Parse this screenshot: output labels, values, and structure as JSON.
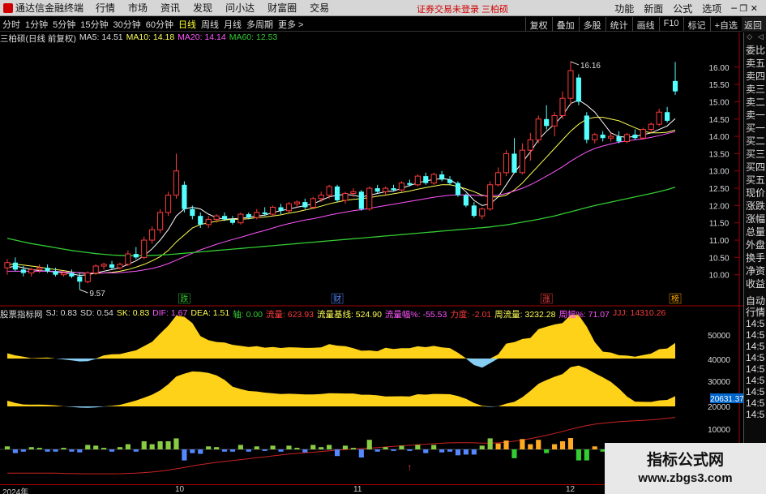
{
  "app": {
    "title": "通达信金融终端",
    "menu": [
      "行情",
      "市场",
      "资讯",
      "发现",
      "问小达",
      "财富圈",
      "交易"
    ],
    "notice": "证券交易未登录  三柏硕",
    "right_menu": [
      "功能",
      "新面",
      "公式",
      "选项"
    ],
    "window_controls": "─ ❐ ✕"
  },
  "periods": {
    "items": [
      "分时",
      "1分钟",
      "5分钟",
      "15分钟",
      "30分钟",
      "60分钟",
      "日线",
      "周线",
      "月线",
      "多周期",
      "更多 >"
    ],
    "active": "日线"
  },
  "tools": [
    "复权",
    "叠加",
    "多股",
    "统计",
    "画线",
    "F10",
    "标记",
    "+自选"
  ],
  "back_label": "返回",
  "main_header": {
    "name": "三柏硕(日线 前复权)",
    "ma5": "MA5: 14.51",
    "ma10": "MA10: 14.18",
    "ma20": "MA20: 14.14",
    "ma60": "MA60: 12.53"
  },
  "price_axis": [
    "16.00",
    "15.50",
    "15.00",
    "14.50",
    "14.00",
    "13.50",
    "13.00",
    "12.50",
    "12.00",
    "11.50",
    "11.00",
    "10.50",
    "10.00"
  ],
  "annotations": {
    "high": "16.16",
    "low": "9.57"
  },
  "markers": [
    "跌",
    "财",
    "涨",
    "榜"
  ],
  "right_panel": [
    "委比",
    "卖五",
    "卖四",
    "卖三",
    "卖二",
    "卖一",
    "买一",
    "买二",
    "买三",
    "买四",
    "买五",
    "现价",
    "涨跌",
    "涨幅",
    "总量",
    "外盘",
    "换手",
    "净资",
    "收益"
  ],
  "right_panel_lower": [
    "自动",
    "行情",
    "14:5",
    "14:5",
    "14:5",
    "14:5",
    "14:5",
    "14:5",
    "14:5",
    "14:5",
    "14:5"
  ],
  "indicator_header": {
    "name": "股票指标网",
    "sj": "SJ: 0.83",
    "sd": "SD: 0.54",
    "sk": "SK: 0.83",
    "dif": "DIF: 1.67",
    "dea": "DEA: 1.51",
    "zhou": "轴: 0.00",
    "liuliang": "流量: 623.93",
    "jixian": "流量基线: 524.90",
    "fudu": "流量幅%: -55.53",
    "lidu": "力度: -2.01",
    "zhouliang": "周流量: 3232.28",
    "zhoufu": "周幅%: 71.07",
    "jjj": "JJJ: 14310.26"
  },
  "indicator_axis": [
    "50000",
    "40000",
    "30000",
    "20000",
    "10000"
  ],
  "indicator_highlight": "20631.37",
  "time_axis": [
    "2024年",
    "10",
    "11",
    "12"
  ],
  "watermark": {
    "line1": "指标公式网",
    "line2": "www.zbgs3.com"
  },
  "colors": {
    "up": "#ff3b3b",
    "down": "#54ffff",
    "ma5": "#ffffff",
    "ma10": "#ffff55",
    "ma20": "#ff55ff",
    "ma60": "#33cc33",
    "yellow_fill": "#ffd21a",
    "blue_fill": "#87cef5"
  },
  "chart_data": {
    "type": "candlestick",
    "title": "三柏硕(日线 前复权)",
    "ylim": [
      9.5,
      16.3
    ],
    "series": [
      {
        "name": "K线",
        "ohlc": [
          [
            10.2,
            10.45,
            10.0,
            10.35
          ],
          [
            10.35,
            10.5,
            10.1,
            10.15
          ],
          [
            10.15,
            10.25,
            9.95,
            10.05
          ],
          [
            10.05,
            10.2,
            9.95,
            10.15
          ],
          [
            10.15,
            10.3,
            10.05,
            10.2
          ],
          [
            10.2,
            10.3,
            10.05,
            10.1
          ],
          [
            10.1,
            10.2,
            9.95,
            10.0
          ],
          [
            10.0,
            10.1,
            9.95,
            10.05
          ],
          [
            10.05,
            10.15,
            9.9,
            9.95
          ],
          [
            9.95,
            10.05,
            9.57,
            9.8
          ],
          [
            9.8,
            10.1,
            9.75,
            10.05
          ],
          [
            10.05,
            10.3,
            10.0,
            10.25
          ],
          [
            10.25,
            10.35,
            10.15,
            10.3
          ],
          [
            10.3,
            10.4,
            10.15,
            10.2
          ],
          [
            10.2,
            10.35,
            10.15,
            10.3
          ],
          [
            10.3,
            10.7,
            10.25,
            10.6
          ],
          [
            10.6,
            10.8,
            10.45,
            10.5
          ],
          [
            10.5,
            11.1,
            10.45,
            11.0
          ],
          [
            11.0,
            11.4,
            10.9,
            11.3
          ],
          [
            11.3,
            11.9,
            11.2,
            11.8
          ],
          [
            11.8,
            12.4,
            11.7,
            12.3
          ],
          [
            12.3,
            13.5,
            12.2,
            13.0
          ],
          [
            12.6,
            12.7,
            11.8,
            11.9
          ],
          [
            11.9,
            12.0,
            11.6,
            11.7
          ],
          [
            11.7,
            11.8,
            11.35,
            11.45
          ],
          [
            11.45,
            11.7,
            11.35,
            11.6
          ],
          [
            11.6,
            11.75,
            11.5,
            11.7
          ],
          [
            11.7,
            11.8,
            11.55,
            11.6
          ],
          [
            11.6,
            11.7,
            11.45,
            11.5
          ],
          [
            11.5,
            11.8,
            11.45,
            11.75
          ],
          [
            11.75,
            11.8,
            11.6,
            11.65
          ],
          [
            11.65,
            11.9,
            11.6,
            11.8
          ],
          [
            11.8,
            11.95,
            11.7,
            11.75
          ],
          [
            11.75,
            12.0,
            11.7,
            11.95
          ],
          [
            11.95,
            12.05,
            11.75,
            11.85
          ],
          [
            11.85,
            12.1,
            11.8,
            12.05
          ],
          [
            12.05,
            12.15,
            11.95,
            12.1
          ],
          [
            12.1,
            12.2,
            11.9,
            11.95
          ],
          [
            11.95,
            12.25,
            11.9,
            12.2
          ],
          [
            12.2,
            12.4,
            12.1,
            12.3
          ],
          [
            12.3,
            12.6,
            12.2,
            12.55
          ],
          [
            12.55,
            12.6,
            12.1,
            12.15
          ],
          [
            12.15,
            12.4,
            12.05,
            12.35
          ],
          [
            12.35,
            12.5,
            12.25,
            12.4
          ],
          [
            12.4,
            12.45,
            11.85,
            11.9
          ],
          [
            11.9,
            12.55,
            11.85,
            12.5
          ],
          [
            12.5,
            12.6,
            12.35,
            12.4
          ],
          [
            12.4,
            12.55,
            12.3,
            12.5
          ],
          [
            12.5,
            12.6,
            12.4,
            12.45
          ],
          [
            12.45,
            12.7,
            12.4,
            12.65
          ],
          [
            12.65,
            12.75,
            12.55,
            12.6
          ],
          [
            12.6,
            12.9,
            12.55,
            12.85
          ],
          [
            12.85,
            12.95,
            12.6,
            12.65
          ],
          [
            12.65,
            12.95,
            12.6,
            12.9
          ],
          [
            12.9,
            13.0,
            12.7,
            12.75
          ],
          [
            12.75,
            12.85,
            12.6,
            12.65
          ],
          [
            12.65,
            12.7,
            12.25,
            12.3
          ],
          [
            12.3,
            12.35,
            11.95,
            12.0
          ],
          [
            12.0,
            12.1,
            11.65,
            11.7
          ],
          [
            11.7,
            11.95,
            11.6,
            11.9
          ],
          [
            11.9,
            12.7,
            11.85,
            12.6
          ],
          [
            12.6,
            13.1,
            12.55,
            12.95
          ],
          [
            12.95,
            13.6,
            12.85,
            13.5
          ],
          [
            13.5,
            13.95,
            13.2,
            12.95
          ],
          [
            12.95,
            13.8,
            12.9,
            13.6
          ],
          [
            13.6,
            14.1,
            13.3,
            13.9
          ],
          [
            13.9,
            14.6,
            13.8,
            14.5
          ],
          [
            14.5,
            14.9,
            14.2,
            14.3
          ],
          [
            14.3,
            14.7,
            14.0,
            14.6
          ],
          [
            14.6,
            15.3,
            14.5,
            15.1
          ],
          [
            15.1,
            16.16,
            14.9,
            15.9
          ],
          [
            15.7,
            15.8,
            14.9,
            15.0
          ],
          [
            14.6,
            14.7,
            13.8,
            13.9
          ],
          [
            13.9,
            14.1,
            13.8,
            14.05
          ],
          [
            14.05,
            14.15,
            13.85,
            13.95
          ],
          [
            13.95,
            14.1,
            13.85,
            14.0
          ],
          [
            14.0,
            14.15,
            13.8,
            13.85
          ],
          [
            13.85,
            14.1,
            13.8,
            14.05
          ],
          [
            14.05,
            14.2,
            13.9,
            13.95
          ],
          [
            13.95,
            14.25,
            13.9,
            14.2
          ],
          [
            14.2,
            14.4,
            14.1,
            14.35
          ],
          [
            14.35,
            14.8,
            14.3,
            14.7
          ],
          [
            14.7,
            14.85,
            14.4,
            14.45
          ],
          [
            15.6,
            16.15,
            15.2,
            15.3
          ]
        ]
      },
      {
        "name": "MA5",
        "values": [
          10.2,
          10.25,
          10.2,
          10.15,
          10.12,
          10.1,
          10.08,
          10.06,
          10.02,
          9.98,
          10.0,
          10.05,
          10.1,
          10.15,
          10.2,
          10.3,
          10.4,
          10.55,
          10.75,
          11.0,
          11.3,
          11.7,
          11.9,
          11.95,
          11.9,
          11.75,
          11.65,
          11.6,
          11.62,
          11.63,
          11.66,
          11.7,
          11.72,
          11.8,
          11.85,
          11.9,
          11.95,
          12.0,
          12.05,
          12.15,
          12.25,
          12.3,
          12.32,
          12.3,
          12.25,
          12.3,
          12.35,
          12.4,
          12.42,
          12.5,
          12.58,
          12.65,
          12.72,
          12.75,
          12.78,
          12.75,
          12.6,
          12.4,
          12.15,
          12.0,
          12.05,
          12.25,
          12.6,
          12.95,
          13.25,
          13.55,
          13.9,
          14.15,
          14.35,
          14.6,
          14.95,
          15.05,
          14.9,
          14.7,
          14.4,
          14.1,
          14.0,
          13.97,
          14.0,
          14.05,
          14.1,
          14.2,
          14.3,
          14.51
        ]
      },
      {
        "name": "MA10",
        "values": [
          10.3,
          10.3,
          10.28,
          10.25,
          10.22,
          10.18,
          10.15,
          10.12,
          10.08,
          10.05,
          10.04,
          10.04,
          10.05,
          10.07,
          10.1,
          10.15,
          10.22,
          10.3,
          10.4,
          10.52,
          10.7,
          10.95,
          11.15,
          11.35,
          11.45,
          11.5,
          11.55,
          11.58,
          11.6,
          11.6,
          11.62,
          11.65,
          11.67,
          11.7,
          11.73,
          11.78,
          11.82,
          11.87,
          11.92,
          11.98,
          12.05,
          12.1,
          12.15,
          12.18,
          12.2,
          12.23,
          12.27,
          12.3,
          12.34,
          12.38,
          12.42,
          12.47,
          12.52,
          12.56,
          12.6,
          12.6,
          12.55,
          12.48,
          12.4,
          12.3,
          12.25,
          12.25,
          12.3,
          12.45,
          12.65,
          12.9,
          13.15,
          13.4,
          13.65,
          13.9,
          14.15,
          14.35,
          14.5,
          14.55,
          14.55,
          14.5,
          14.45,
          14.35,
          14.25,
          14.15,
          14.1,
          14.1,
          14.12,
          14.18
        ]
      },
      {
        "name": "MA20",
        "values": [
          10.1,
          10.1,
          10.1,
          10.1,
          10.1,
          10.1,
          10.1,
          10.08,
          10.07,
          10.06,
          10.05,
          10.05,
          10.05,
          10.05,
          10.06,
          10.08,
          10.1,
          10.14,
          10.18,
          10.24,
          10.32,
          10.42,
          10.52,
          10.62,
          10.72,
          10.8,
          10.88,
          10.95,
          11.02,
          11.08,
          11.15,
          11.22,
          11.28,
          11.35,
          11.42,
          11.48,
          11.53,
          11.58,
          11.62,
          11.67,
          11.72,
          11.77,
          11.81,
          11.85,
          11.88,
          11.92,
          11.96,
          12.0,
          12.04,
          12.08,
          12.12,
          12.16,
          12.2,
          12.24,
          12.27,
          12.3,
          12.31,
          12.31,
          12.3,
          12.28,
          12.28,
          12.3,
          12.35,
          12.42,
          12.5,
          12.6,
          12.72,
          12.85,
          12.98,
          13.12,
          13.28,
          13.42,
          13.55,
          13.65,
          13.72,
          13.78,
          13.83,
          13.87,
          13.9,
          13.93,
          13.97,
          14.02,
          14.08,
          14.14
        ]
      },
      {
        "name": "MA60",
        "values": [
          11.05,
          11.0,
          10.95,
          10.9,
          10.86,
          10.82,
          10.78,
          10.74,
          10.7,
          10.67,
          10.64,
          10.61,
          10.59,
          10.57,
          10.56,
          10.55,
          10.55,
          10.55,
          10.56,
          10.57,
          10.58,
          10.6,
          10.62,
          10.64,
          10.66,
          10.68,
          10.7,
          10.72,
          10.74,
          10.76,
          10.78,
          10.8,
          10.82,
          10.84,
          10.86,
          10.88,
          10.9,
          10.92,
          10.94,
          10.96,
          10.98,
          11.0,
          11.02,
          11.04,
          11.06,
          11.08,
          11.1,
          11.12,
          11.14,
          11.16,
          11.18,
          11.2,
          11.22,
          11.24,
          11.26,
          11.28,
          11.3,
          11.32,
          11.34,
          11.36,
          11.38,
          11.41,
          11.44,
          11.48,
          11.52,
          11.56,
          11.6,
          11.65,
          11.7,
          11.76,
          11.82,
          11.88,
          11.94,
          12.0,
          12.05,
          12.1,
          12.15,
          12.2,
          12.25,
          12.3,
          12.35,
          12.4,
          12.46,
          12.53
        ]
      }
    ]
  }
}
